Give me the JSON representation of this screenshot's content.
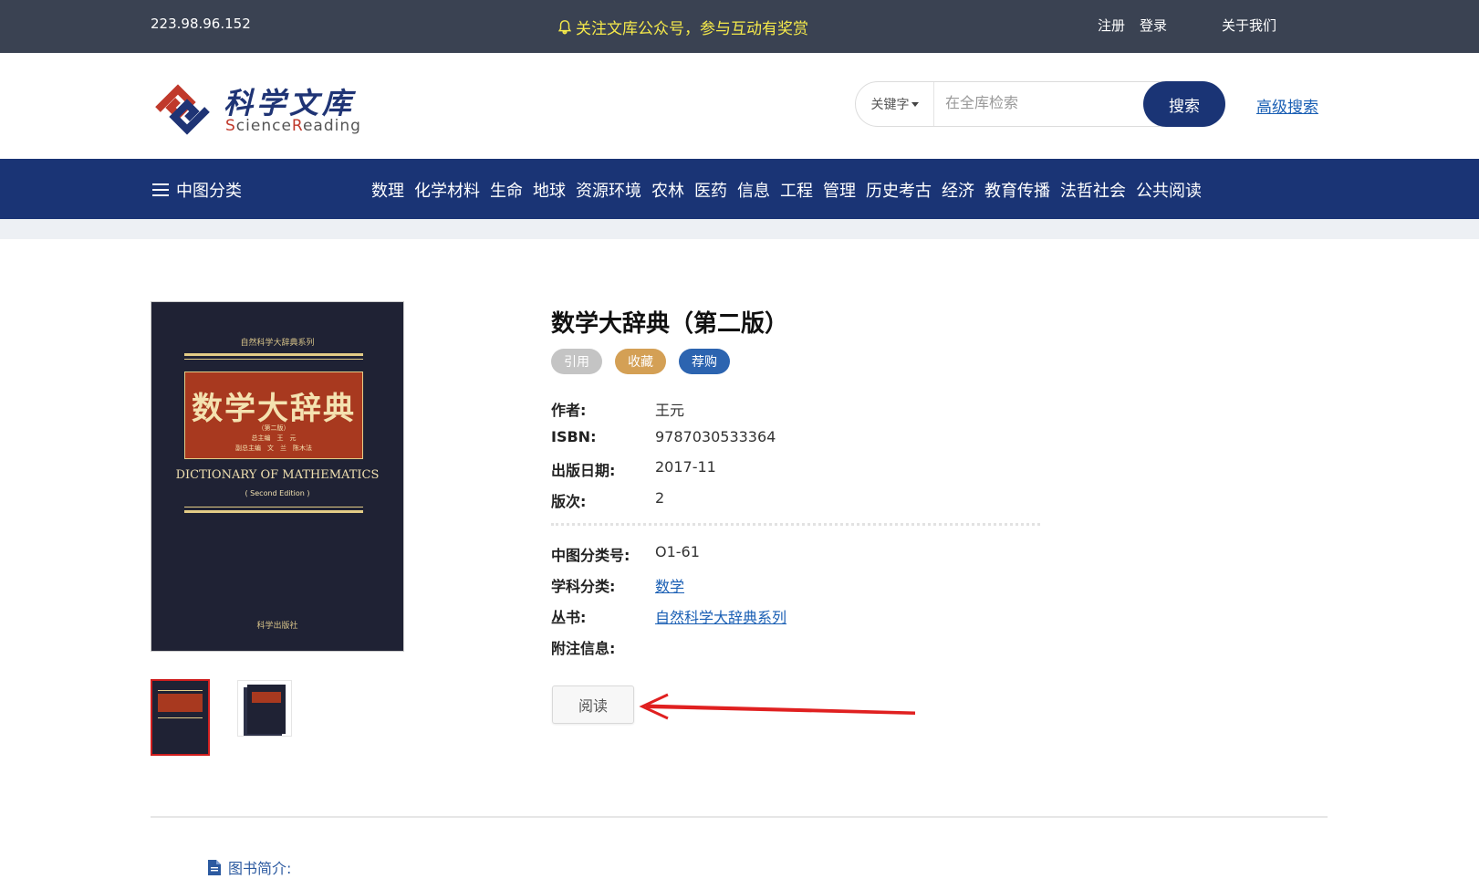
{
  "topbar": {
    "ip": "223.98.96.152",
    "notice": "关注文库公众号，参与互动有奖赏",
    "register": "注册",
    "login": "登录",
    "about": "关于我们"
  },
  "header": {
    "logo_cn": "科学文库",
    "logo_en_prefix": "S",
    "logo_en_rest": "cience",
    "logo_en_r": "R",
    "logo_en_tail": "eading",
    "search_mode": "关键字",
    "search_placeholder": "在全库检索",
    "search_button": "搜索",
    "advanced_search": "高级搜索"
  },
  "nav": {
    "category_label": "中图分类",
    "items": [
      "数理",
      "化学材料",
      "生命",
      "地球",
      "资源环境",
      "农林",
      "医药",
      "信息",
      "工程",
      "管理",
      "历史考古",
      "经济",
      "教育传播",
      "法哲社会",
      "公共阅读"
    ]
  },
  "book": {
    "cover": {
      "series": "自然科学大辞典系列",
      "title": "数学大辞典",
      "edition": "（第二版）",
      "editor1": "总主编　王　元",
      "editor2": "副总主编　文　兰　陈木法",
      "title_en": "DICTIONARY OF MATHEMATICS",
      "edition_en": "( Second Edition )",
      "publisher": "科学出版社"
    },
    "title": "数学大辞典（第二版）",
    "tags": {
      "cite": "引用",
      "favorite": "收藏",
      "recommend": "荐购"
    },
    "fields": {
      "author_label": "作者:",
      "author": "王元",
      "isbn_label": "ISBN:",
      "isbn": "9787030533364",
      "date_label": "出版日期:",
      "date": "2017-11",
      "edition_label": "版次:",
      "edition": "2",
      "clc_label": "中图分类号:",
      "clc": "O1-61",
      "subject_label": "学科分类:",
      "subject": "数学",
      "series_label": "丛书:",
      "series": "自然科学大辞典系列",
      "notes_label": "附注信息:",
      "notes": ""
    },
    "read_button": "阅读",
    "intro_label": "图书简介:"
  },
  "colors": {
    "topbar_bg": "#3a4252",
    "notice": "#f5e94a",
    "brand_navy": "#1a3475",
    "link": "#1a5fb4",
    "annotation_arrow": "#e02020"
  }
}
